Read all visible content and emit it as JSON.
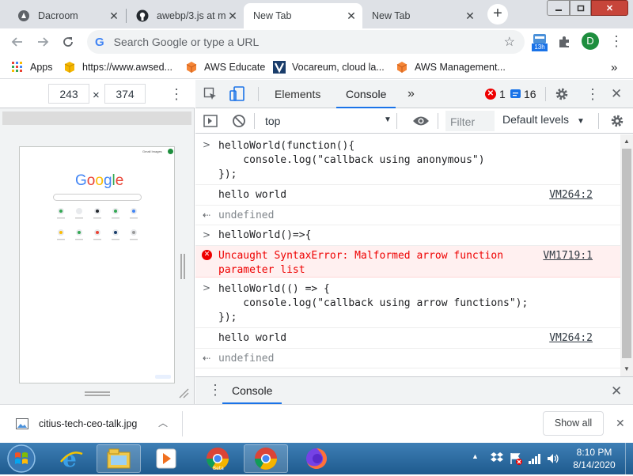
{
  "tabs": [
    {
      "title": "Dacroom",
      "icon": "dacroom-icon",
      "active": false
    },
    {
      "title": "awebp/3.js at m",
      "icon": "github-icon",
      "active": false
    },
    {
      "title": "New Tab",
      "icon": "",
      "active": true
    },
    {
      "title": "New Tab",
      "icon": "",
      "active": false
    }
  ],
  "omnibox": {
    "placeholder": "Search Google or type a URL",
    "google_glyph": "G"
  },
  "profile": {
    "initial": "D",
    "extension_badge": "13h"
  },
  "bookmarks": [
    {
      "label": "Apps",
      "icon": "apps-icon"
    },
    {
      "label": "https://www.awsed...",
      "icon": "box-icon"
    },
    {
      "label": "AWS Educate",
      "icon": "aws-cube-icon"
    },
    {
      "label": "Vocareum, cloud la...",
      "icon": "vocareum-icon"
    },
    {
      "label": "AWS Management...",
      "icon": "aws-cube-icon"
    }
  ],
  "bookmarks_overflow": "»",
  "device": {
    "width": "243",
    "height": "374",
    "times": "×"
  },
  "viewport": {
    "logo": "Google",
    "header_links": "Gmail  Images"
  },
  "devtools": {
    "tabs": [
      "Elements",
      "Console"
    ],
    "more": "»",
    "error_count": "1",
    "message_count": "16",
    "context": "top",
    "filter_placeholder": "Filter",
    "levels": "Default levels"
  },
  "console": [
    {
      "kind": "input",
      "lines": [
        "helloWorld(function(){",
        "    console.log(\"callback using anonymous\")",
        "});"
      ]
    },
    {
      "kind": "log",
      "text": "hello world",
      "source": "VM264:2"
    },
    {
      "kind": "result",
      "text": "undefined"
    },
    {
      "kind": "input",
      "lines": [
        "helloWorld()=>{"
      ]
    },
    {
      "kind": "error",
      "lines": [
        "Uncaught SyntaxError: Malformed arrow function",
        "parameter list"
      ],
      "source": "VM1719:1"
    },
    {
      "kind": "input",
      "lines": [
        "helloWorld(() => {",
        "    console.log(\"callback using arrow functions\");",
        "});"
      ]
    },
    {
      "kind": "log",
      "text": "hello world",
      "source": "VM264:2"
    },
    {
      "kind": "result",
      "text": "undefined"
    }
  ],
  "drawer": {
    "tab": "Console"
  },
  "download": {
    "filename": "citius-tech-ceo-talk.jpg",
    "show_all": "Show all"
  },
  "clock": {
    "time": "8:10 PM",
    "date": "8/14/2020"
  },
  "colors": {
    "accent": "#1a73e8",
    "error": "#e00000",
    "taskbar": "#2b6ba3"
  }
}
